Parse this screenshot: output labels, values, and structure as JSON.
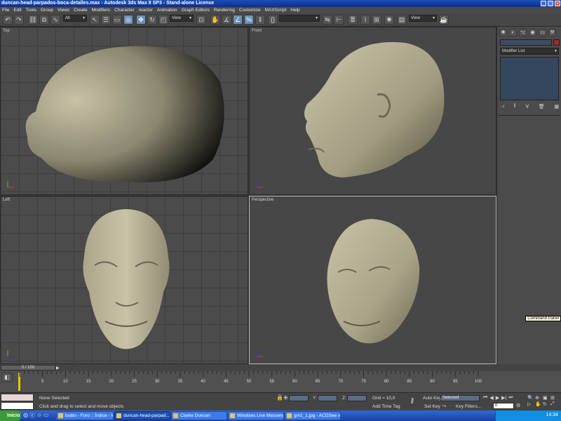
{
  "window": {
    "title": "duncan-head-parpados-boca-detalles.max - Autodesk 3ds Max 8 SP3 - Stand-alone License"
  },
  "menu": [
    "File",
    "Edit",
    "Tools",
    "Group",
    "Views",
    "Create",
    "Modifiers",
    "Character",
    "reactor",
    "Animation",
    "Graph Editors",
    "Rendering",
    "Customize",
    "MAXScript",
    "Help"
  ],
  "toolbar": {
    "selection_filter": "All",
    "ref_coord": "View",
    "named_selection": "",
    "render_view": "View"
  },
  "viewports": {
    "top": "Top",
    "front": "Front",
    "left": "Left",
    "perspective": "Perspective"
  },
  "command_panel": {
    "modifier_list": "Modifier List",
    "color": "#b0202c",
    "tooltip": "Command Panel"
  },
  "timeline": {
    "frame_display": "0 / 100",
    "ticks": [
      "5",
      "10",
      "15",
      "20",
      "25",
      "30",
      "35",
      "40",
      "45",
      "50",
      "55",
      "60",
      "65",
      "70",
      "75",
      "80",
      "85",
      "90",
      "95",
      "100"
    ]
  },
  "status": {
    "selection": "None Selected",
    "prompt": "Click and drag to select and move objects",
    "x_label": "X:",
    "y_label": "Y:",
    "z_label": "Z:",
    "grid": "Grid = 10,0",
    "add_time_tag": "Add Time Tag",
    "auto_key": "Auto Key",
    "set_key": "Set Key",
    "key_mode": "Selected",
    "key_filters": "Key Filters...",
    "frame_value": "0"
  },
  "taskbar": {
    "start": "Inicio",
    "items": [
      "bulbo - Foro :: Índice - M...",
      "duncan-head-parpad...",
      "Clarke Duncan",
      "Windows Live Messenger",
      "gm1_1.jpg - ACDSee v5.0"
    ],
    "clock": "14:34"
  }
}
